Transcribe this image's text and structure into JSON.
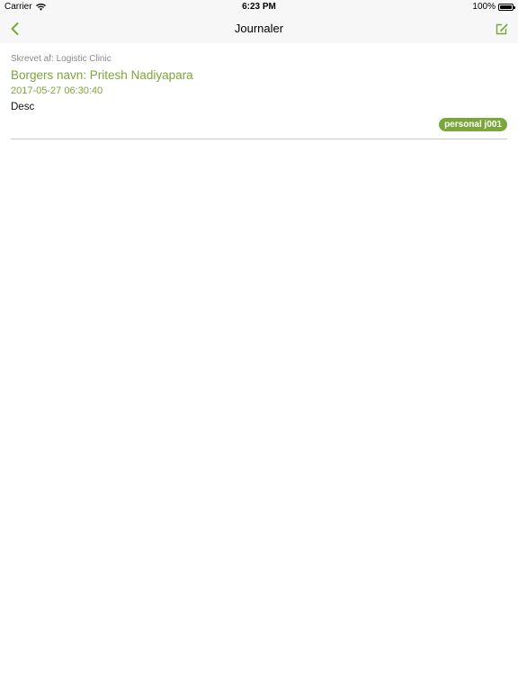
{
  "status_bar": {
    "carrier": "Carrier",
    "time": "6:23 PM",
    "battery_percent": "100%",
    "battery_level": 1.0
  },
  "nav": {
    "title": "Journaler",
    "back_icon": "chevron-left-icon",
    "compose_icon": "compose-icon"
  },
  "journal_entries": [
    {
      "author": "Skrevet af: Logistic Clinic",
      "citizen_name": "Borgers navn: Pritesh Nadiyapara",
      "datetime": "2017-05-27 06:30:40",
      "description": "Desc",
      "tag": "personal j001"
    }
  ],
  "colors": {
    "accent": "#7aa63a",
    "bar_background": "#f7f7f7",
    "muted_text": "#8a8a8a",
    "divider": "#c9c9c9"
  }
}
